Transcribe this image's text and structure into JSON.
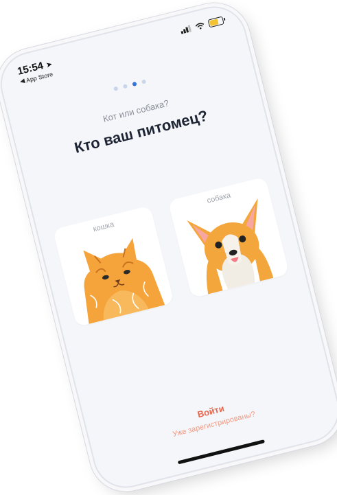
{
  "status_bar": {
    "time": "15:54",
    "back_app": "App Store",
    "location_icon": "location-arrow-icon",
    "signal_icon": "cellular-signal-icon",
    "wifi_icon": "wifi-icon",
    "battery_icon": "battery-icon",
    "battery_color": "#f2c230"
  },
  "pager": {
    "count": 4,
    "active_index": 2,
    "active_color": "#2f73d9",
    "inactive_color": "#c9d6ea"
  },
  "header": {
    "subtitle": "Кот или собака?",
    "title": "Кто ваш питомец?"
  },
  "choices": [
    {
      "label": "кошка",
      "illustration": "cat-illustration"
    },
    {
      "label": "собака",
      "illustration": "dog-illustration"
    }
  ],
  "footer": {
    "login_label": "Войти",
    "registered_text": "Уже зарегистрированы?",
    "accent_color": "#e8664f"
  }
}
